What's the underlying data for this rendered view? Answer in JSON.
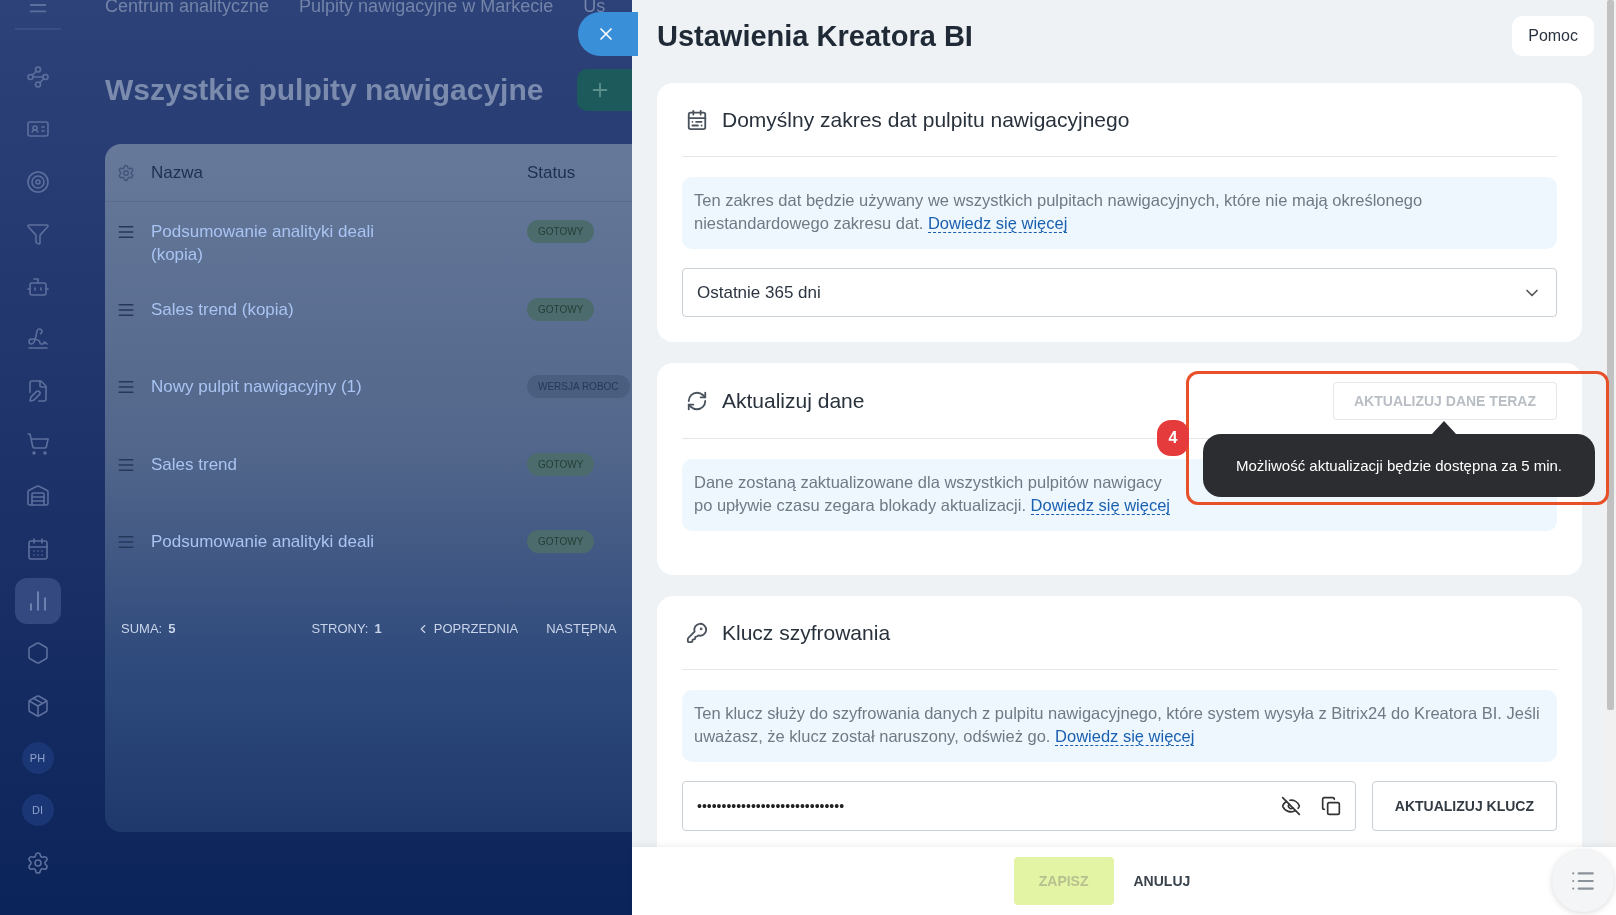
{
  "breadcrumbs": [
    "Centrum analityczne",
    "Pulpity nawigacyjne w Markecie",
    "Us"
  ],
  "sidebar": {
    "items": [
      {
        "kind": "icon",
        "selected": false
      },
      {
        "kind": "icon",
        "selected": false
      },
      {
        "kind": "icon",
        "selected": false
      },
      {
        "kind": "icon",
        "selected": false
      },
      {
        "kind": "icon",
        "selected": false
      },
      {
        "kind": "icon",
        "selected": false
      },
      {
        "kind": "icon",
        "selected": false
      },
      {
        "kind": "icon",
        "selected": false
      },
      {
        "kind": "icon",
        "selected": false
      },
      {
        "kind": "icon",
        "selected": false
      },
      {
        "kind": "icon",
        "selected": true
      },
      {
        "kind": "icon",
        "selected": false
      },
      {
        "kind": "icon",
        "selected": false
      },
      {
        "kind": "avatar",
        "label": "PH",
        "selected": false
      },
      {
        "kind": "avatar",
        "label": "DI",
        "selected": false
      },
      {
        "kind": "icon",
        "selected": false
      }
    ]
  },
  "page": {
    "title": "Wszystkie pulpity nawigacyjne"
  },
  "table": {
    "columns": [
      "Nazwa",
      "Status"
    ],
    "rows": [
      {
        "name": "Podsumowanie analityki deali (kopia)",
        "status": "GOTOWY",
        "kind": "ready"
      },
      {
        "name": "Sales trend (kopia)",
        "status": "GOTOWY",
        "kind": "ready"
      },
      {
        "name": "Nowy pulpit nawigacyjny (1)",
        "status": "WERSJA ROBOC",
        "kind": "draft"
      },
      {
        "name": "Sales trend",
        "status": "GOTOWY",
        "kind": "ready"
      },
      {
        "name": "Podsumowanie analityki deali",
        "status": "GOTOWY",
        "kind": "ready"
      }
    ],
    "footer": {
      "total_label": "SUMA:",
      "total": "5",
      "pages_label": "STRONY:",
      "pages": "1",
      "prev": "POPRZEDNIA",
      "next": "NASTĘPNA"
    }
  },
  "panel": {
    "title": "Ustawienia Kreatora BI",
    "help_button": "Pomoc",
    "sections": [
      {
        "kind": "date_range",
        "title": "Domyślny zakres dat pulpitu nawigacyjnego",
        "info": "Ten zakres dat będzie używany we wszystkich pulpitach nawigacyjnych, które nie mają określonego niestandardowego zakresu dat.",
        "link": "Dowiedz się więcej",
        "select_value": "Ostatnie 365 dni"
      },
      {
        "kind": "refresh",
        "title": "Aktualizuj dane",
        "button": {
          "label": "AKTUALIZUJ DANE TERAZ",
          "disabled": true
        },
        "info": "Dane zostaną zaktualizowane dla wszystkich pulpitów nawigacy",
        "info_continued": "po upływie czasu zegara blokady aktualizacji.",
        "link": "Dowiedz się więcej"
      },
      {
        "kind": "key",
        "title": "Klucz szyfrowania",
        "info": "Ten klucz służy do szyfrowania danych z pulpitu nawigacyjnego, które system wysyła z Bitrix24 do Kreatora BI. Jeśli uważasz, że klucz został naruszony, odśwież go.",
        "link": "Dowiedz się więcej",
        "key_value": "••••••••••••••••••••••••••••••",
        "button": "AKTUALIZUJ KLUCZ"
      }
    ],
    "tooltip": "Możliwość aktualizacji będzie dostępna za 5 min.",
    "annotation_badge": "4",
    "footer": {
      "save": {
        "label": "ZAPISZ",
        "disabled": true
      },
      "cancel": "ANULUJ"
    }
  }
}
